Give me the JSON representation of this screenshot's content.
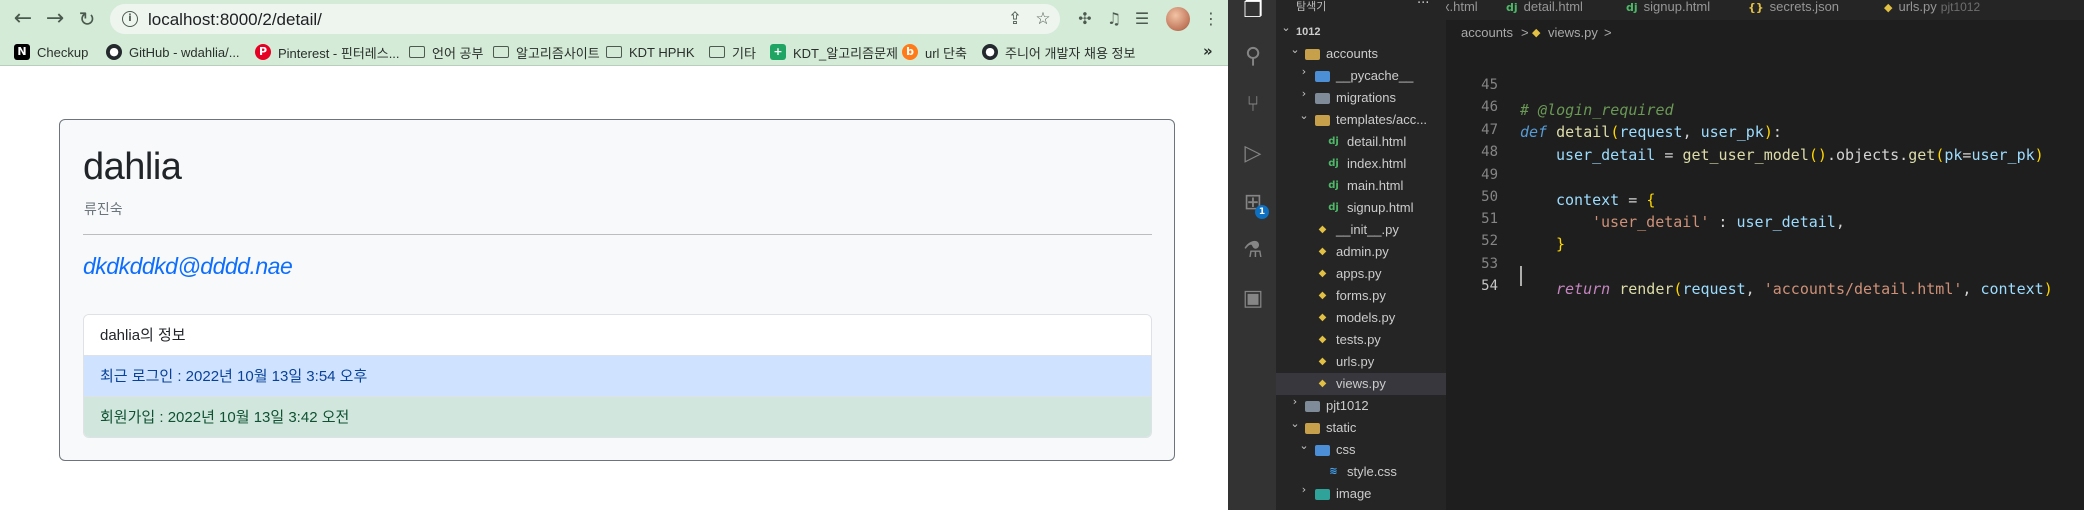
{
  "browser": {
    "url": "localhost:8000/2/detail/",
    "bookmarks": [
      {
        "label": "Checkup",
        "icon": "notion-icon"
      },
      {
        "label": "GitHub - wdahlia/...",
        "icon": "github-icon"
      },
      {
        "label": "Pinterest - 핀터레스...",
        "icon": "pinterest-icon"
      },
      {
        "label": "언어 공부",
        "icon": "folder-icon"
      },
      {
        "label": "알고리즘사이트",
        "icon": "folder-icon"
      },
      {
        "label": "KDT HPHK",
        "icon": "folder-icon"
      },
      {
        "label": "기타",
        "icon": "folder-icon"
      },
      {
        "label": "KDT_알고리즘문제",
        "icon": "sheets-icon"
      },
      {
        "label": "url 단축",
        "icon": "url-shortener-icon"
      },
      {
        "label": "주니어 개발자 채용 정보",
        "icon": "github-icon"
      }
    ],
    "page": {
      "username": "dahlia",
      "fullname": "류진숙",
      "email": "dkdkddkd@dddd.nae",
      "info_header": "dahlia의 정보",
      "last_login": "최근 로그인 : 2022년 10월 13일 3:54 오후",
      "date_joined": "회원가입 : 2022년 10월 13일 3:42 오전"
    },
    "colors": {
      "chrome": "#d4ecd7",
      "link": "#0d6efd",
      "info": "#cfe2ff",
      "success": "#d1e7dd"
    }
  },
  "vscode": {
    "explorer_title": "탐색기",
    "tabs": [
      {
        "label": "x.html",
        "icon": "django-icon"
      },
      {
        "label": "detail.html",
        "icon": "django-icon"
      },
      {
        "label": "signup.html",
        "icon": "django-icon"
      },
      {
        "label": "secrets.json",
        "icon": "json-icon"
      },
      {
        "label": "urls.py",
        "muted": "pjt1012",
        "icon": "python-icon"
      }
    ],
    "breadcrumb": [
      "accounts",
      ">",
      "views.py",
      ">"
    ],
    "tree": [
      {
        "label": "1012",
        "type": "root"
      },
      {
        "label": "accounts",
        "type": "folder-open",
        "depth": 1
      },
      {
        "label": "__pycache__",
        "type": "folder-blue",
        "depth": 2
      },
      {
        "label": "migrations",
        "type": "folder",
        "depth": 2
      },
      {
        "label": "templates/acc...",
        "type": "folder-open",
        "depth": 2
      },
      {
        "label": "detail.html",
        "type": "dj",
        "depth": 3
      },
      {
        "label": "index.html",
        "type": "dj",
        "depth": 3
      },
      {
        "label": "main.html",
        "type": "dj",
        "depth": 3
      },
      {
        "label": "signup.html",
        "type": "dj",
        "depth": 3
      },
      {
        "label": "__init__.py",
        "type": "py",
        "depth": 2
      },
      {
        "label": "admin.py",
        "type": "py",
        "depth": 2
      },
      {
        "label": "apps.py",
        "type": "py",
        "depth": 2
      },
      {
        "label": "forms.py",
        "type": "py",
        "depth": 2
      },
      {
        "label": "models.py",
        "type": "py",
        "depth": 2
      },
      {
        "label": "tests.py",
        "type": "py",
        "depth": 2
      },
      {
        "label": "urls.py",
        "type": "py",
        "depth": 2
      },
      {
        "label": "views.py",
        "type": "py",
        "depth": 2,
        "selected": true
      },
      {
        "label": "pjt1012",
        "type": "folder",
        "depth": 1
      },
      {
        "label": "static",
        "type": "folder-open",
        "depth": 1
      },
      {
        "label": "css",
        "type": "folder-blue",
        "depth": 2
      },
      {
        "label": "style.css",
        "type": "css",
        "depth": 3
      },
      {
        "label": "image",
        "type": "folder-teal",
        "depth": 2
      }
    ],
    "code": {
      "line_numbers": [
        "45",
        "46",
        "47",
        "48",
        "49",
        "50",
        "51",
        "52",
        "53",
        "54"
      ],
      "l45": "# @login_required",
      "l46_def": "def",
      "l46_name": "detail",
      "l46_args": [
        "request",
        "user_pk"
      ],
      "l47_var": "user_detail",
      "l47_call1": "get_user_model",
      "l47_mid": ".objects.",
      "l47_call2": "get",
      "l47_kw": "pk",
      "l47_val": "user_pk",
      "l49_var": "context",
      "l50_key": "'user_detail'",
      "l50_val": "user_detail",
      "l53_ret": "return",
      "l53_fn": "render",
      "l53_arg1": "request",
      "l53_str": "'accounts/detail.html'",
      "l53_arg3": "context"
    }
  }
}
